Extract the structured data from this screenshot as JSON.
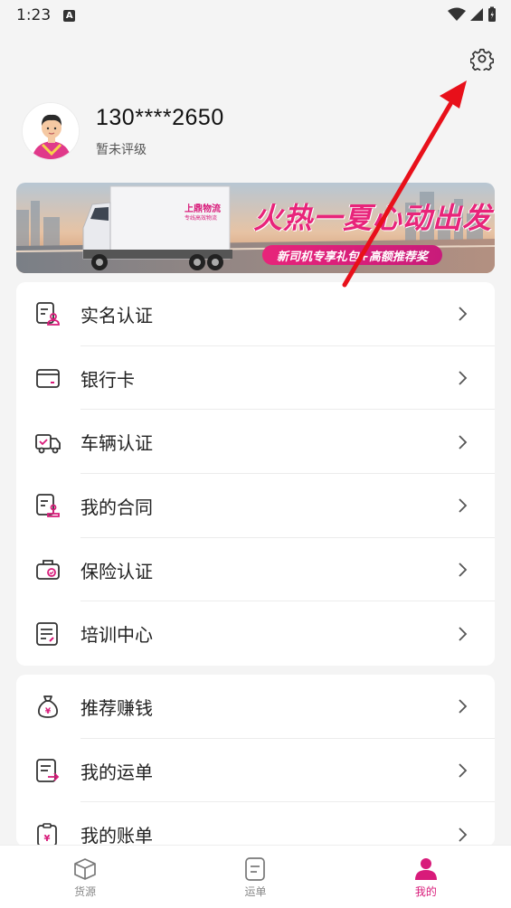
{
  "status_bar": {
    "time": "1:23",
    "notification_badge": "A"
  },
  "header": {
    "settings_icon": "gear-icon"
  },
  "profile": {
    "phone": "130****2650",
    "rating": "暂未评级",
    "avatar_icon": "driver-avatar"
  },
  "banner": {
    "title": "火热一夏心动出发",
    "subtitle": "新司机专享礼包+高额推荐奖",
    "truck_brand": "上鼎物流",
    "truck_tagline": "专线高效物流"
  },
  "menu_group_1": [
    {
      "label": "实名认证",
      "icon": "id-verify-icon"
    },
    {
      "label": "银行卡",
      "icon": "bank-card-icon"
    },
    {
      "label": "车辆认证",
      "icon": "truck-verify-icon"
    },
    {
      "label": "我的合同",
      "icon": "contract-icon"
    },
    {
      "label": "保险认证",
      "icon": "insurance-icon"
    },
    {
      "label": "培训中心",
      "icon": "training-icon"
    }
  ],
  "menu_group_2": [
    {
      "label": "推荐赚钱",
      "icon": "money-bag-icon"
    },
    {
      "label": "我的运单",
      "icon": "waybill-icon"
    },
    {
      "label": "我的账单",
      "icon": "bill-icon"
    }
  ],
  "tabbar": {
    "tabs": [
      {
        "label": "货源",
        "icon": "box-icon",
        "active": false
      },
      {
        "label": "运单",
        "icon": "document-icon",
        "active": false
      },
      {
        "label": "我的",
        "icon": "person-icon",
        "active": true
      }
    ]
  },
  "colors": {
    "accent": "#d81b7a",
    "annotation_arrow": "#e8101a"
  }
}
